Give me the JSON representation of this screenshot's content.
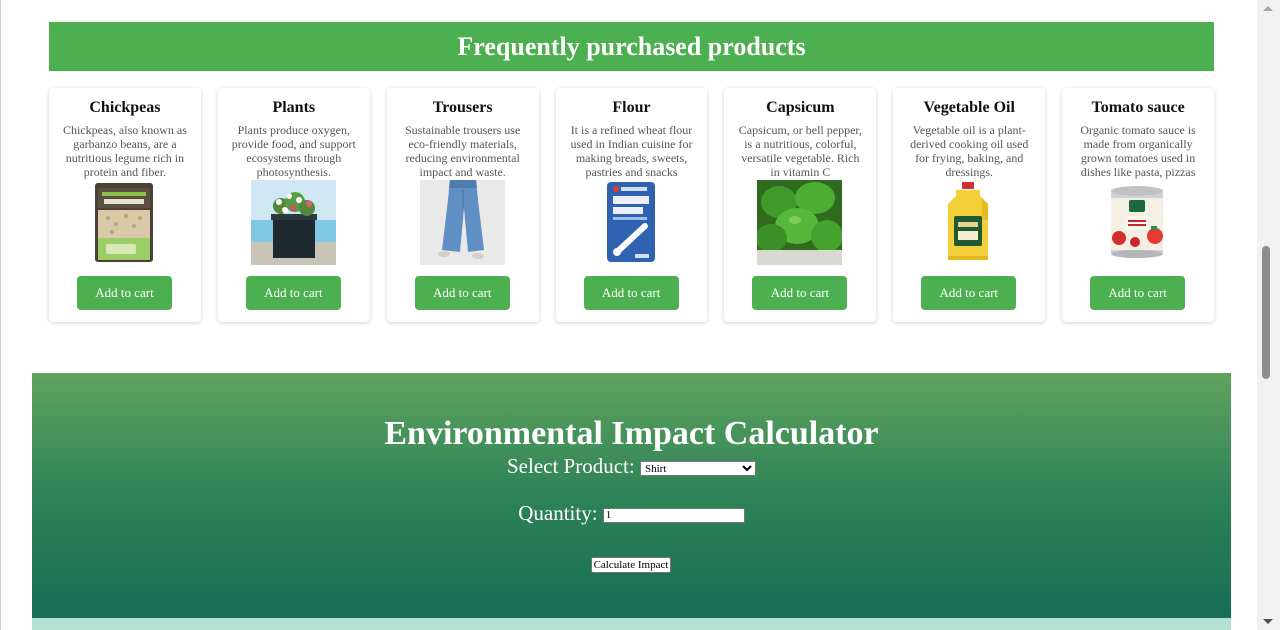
{
  "products_section": {
    "title": "Frequently purchased products",
    "add_label": "Add to cart",
    "items": [
      {
        "name": "Chickpeas",
        "description": "Chickpeas, also known as garbanzo beans, are a nutritious legume rich in protein and fiber.",
        "icon": "chickpeas-bag-icon"
      },
      {
        "name": "Plants",
        "description": "Plants produce oxygen, provide food, and support ecosystems through photosynthesis.",
        "icon": "potted-plant-icon"
      },
      {
        "name": "Trousers",
        "description": "Sustainable trousers use eco-friendly materials, reducing environmental impact and waste.",
        "icon": "trousers-icon"
      },
      {
        "name": "Flour",
        "description": "It is a refined wheat flour used in Indian cuisine for making breads, sweets, pastries and snacks",
        "icon": "flour-bag-icon"
      },
      {
        "name": "Capsicum",
        "description": "Capsicum, or bell pepper, is a nutritious, colorful, versatile vegetable. Rich in vitamin C",
        "icon": "capsicum-icon"
      },
      {
        "name": "Vegetable Oil",
        "description": "Vegetable oil is a plant-derived cooking oil used for frying, baking, and dressings.",
        "icon": "oil-bottle-icon"
      },
      {
        "name": "Tomato sauce",
        "description": "Organic tomato sauce is made from organically grown tomatoes used in dishes like pasta, pizzas",
        "icon": "tomato-sauce-can-icon"
      }
    ]
  },
  "calculator": {
    "title": "Environmental Impact Calculator",
    "product_label": "Select Product:",
    "product_selected": "Shirt",
    "quantity_label": "Quantity:",
    "quantity_value": "1",
    "button_label": "Calculate Impact"
  },
  "colors": {
    "accent_green": "#4caf50",
    "calc_gradient_top": "#5fa35e",
    "calc_gradient_bottom": "#146c55",
    "calc_bottom_strip": "#b6e0d2"
  }
}
